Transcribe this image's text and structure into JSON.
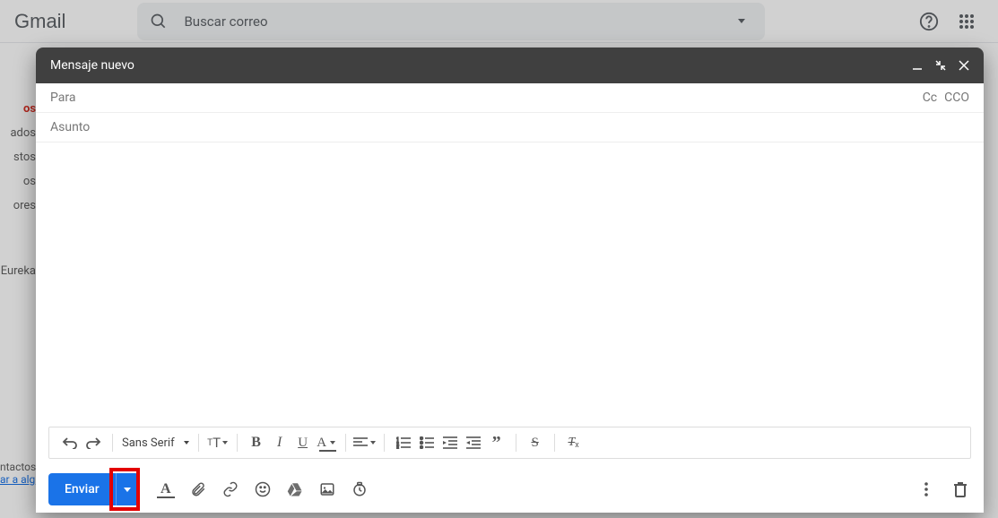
{
  "bg": {
    "logo": "Gmail",
    "search_placeholder": "Buscar correo",
    "sidebar": [
      "os",
      "ados",
      "stos",
      "os",
      "ores",
      "Eureka"
    ],
    "bottom": {
      "contacts": "ntactos",
      "link": "ar a alg"
    }
  },
  "compose": {
    "title": "Mensaje nuevo",
    "to_label": "Para",
    "cc": "Cc",
    "bcc": "CCO",
    "subject_placeholder": "Asunto",
    "font": "Sans Serif",
    "send": "Enviar"
  },
  "toolbar_icons": {
    "undo": "undo",
    "redo": "redo",
    "font_size": "size",
    "bold": "B",
    "italic": "I",
    "underline": "U",
    "color": "A",
    "align": "align",
    "numbered": "ol",
    "bulleted": "ul",
    "indent_less": "<<",
    "indent_more": ">>",
    "quote": "”",
    "strike": "S",
    "clear": "Tx"
  }
}
